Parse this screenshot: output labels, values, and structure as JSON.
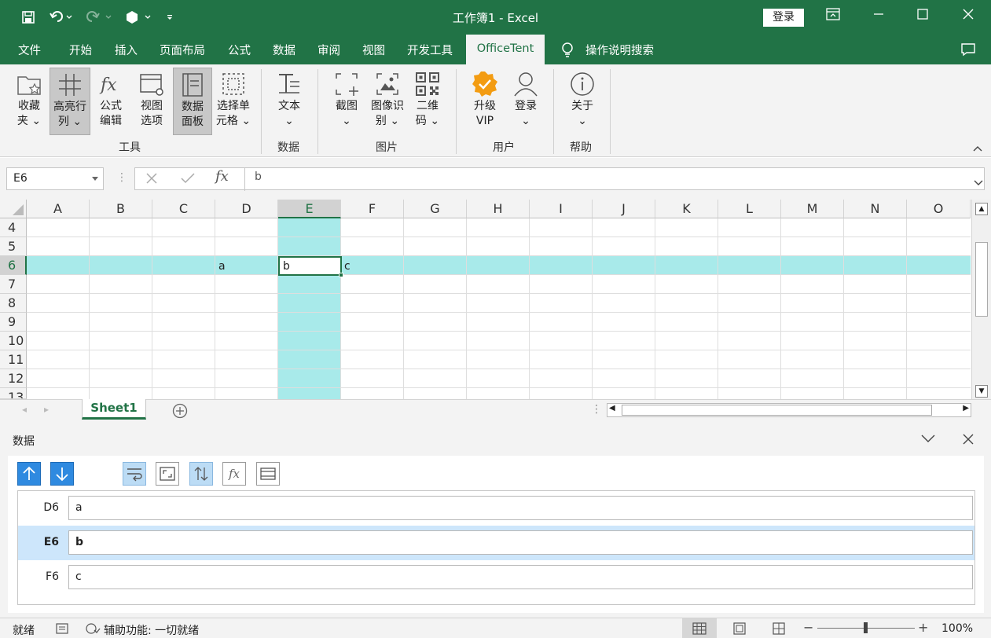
{
  "titlebar": {
    "title": "工作簿1  -  Excel",
    "login": "登录"
  },
  "tabs": [
    "文件",
    "开始",
    "插入",
    "页面布局",
    "公式",
    "数据",
    "审阅",
    "视图",
    "开发工具",
    "OfficeTent"
  ],
  "tell_me": "操作说明搜索",
  "ribbon": {
    "buttons": [
      {
        "l1": "收藏",
        "l2": "夹 ⌄",
        "icon": "folder-star-icon"
      },
      {
        "l1": "高亮行",
        "l2": "列 ⌄",
        "icon": "crosshair-icon"
      },
      {
        "l1": "公式",
        "l2": "编辑",
        "icon": "fx-icon"
      },
      {
        "l1": "视图",
        "l2": "选项",
        "icon": "view-options-icon"
      },
      {
        "l1": "数据",
        "l2": "面板",
        "icon": "data-panel-icon"
      },
      {
        "l1": "选择单",
        "l2": "元格 ⌄",
        "icon": "select-cell-icon"
      },
      {
        "l1": "文本",
        "l2": "⌄",
        "icon": "text-icon"
      },
      {
        "l1": "截图",
        "l2": "⌄",
        "icon": "screenshot-icon"
      },
      {
        "l1": "图像识",
        "l2": "别 ⌄",
        "icon": "image-recognize-icon"
      },
      {
        "l1": "二维",
        "l2": "码 ⌄",
        "icon": "qrcode-icon"
      },
      {
        "l1": "升级",
        "l2": "VIP",
        "icon": "vip-badge-icon"
      },
      {
        "l1": "登录",
        "l2": "⌄",
        "icon": "user-icon"
      },
      {
        "l1": "关于",
        "l2": "⌄",
        "icon": "info-icon"
      }
    ],
    "groups": [
      "工具",
      "数据",
      "图片",
      "用户",
      "帮助"
    ]
  },
  "formula": {
    "namebox": "E6",
    "value": "b",
    "fx": "fx"
  },
  "grid": {
    "columns": [
      "A",
      "B",
      "C",
      "D",
      "E",
      "F",
      "G",
      "H",
      "I",
      "J",
      "K",
      "L",
      "M",
      "N",
      "O"
    ],
    "rows": [
      "4",
      "5",
      "6",
      "7",
      "8",
      "9",
      "10",
      "11",
      "12",
      "13"
    ],
    "cells": {
      "D6": "a",
      "E6": "b",
      "F6": "c"
    }
  },
  "sheet": {
    "name": "Sheet1"
  },
  "panel": {
    "title": "数据",
    "rows": [
      {
        "ref": "D6",
        "value": "a"
      },
      {
        "ref": "E6",
        "value": "b"
      },
      {
        "ref": "F6",
        "value": "c"
      }
    ]
  },
  "status": {
    "ready": "就绪",
    "accessibility": "辅助功能: 一切就绪",
    "zoom": "100%"
  },
  "colors": {
    "brand": "#217346",
    "highlight": "#a8eaea",
    "panel_blue": "#2f8ae0"
  }
}
